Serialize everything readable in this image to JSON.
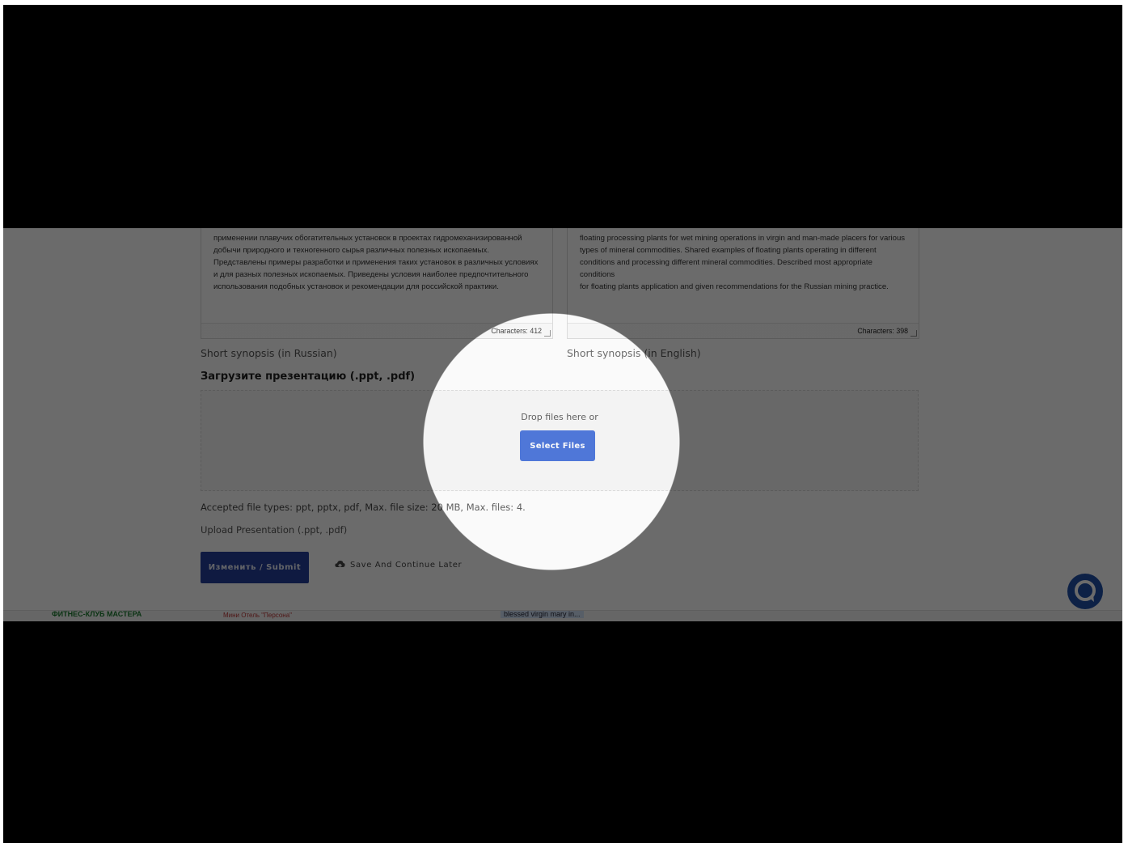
{
  "form": {
    "synopsis_ru": {
      "text": "применении плавучих обогатительных установок в проектах гидромеханизированной\nдобычи природного и техногенного сырья различных полезных ископаемых.\nПредставлены примеры разработки и применения таких установок в различных условиях\nи для разных полезных ископаемых. Приведены условия наиболее предпочтительного\nиспользования подобных установок и рекомендации для российской практики.",
      "counter": "Characters: 412",
      "description": "Short synopsis (in Russian)"
    },
    "synopsis_en": {
      "text": "floating processing plants for wet mining operations in virgin and man-made placers for various\ntypes of mineral commodities. Shared examples of floating plants operating in different\nconditions and processing different mineral commodities. Described most appropriate conditions\nfor floating plants application and given recommendations for the Russian mining practice.",
      "counter": "Characters: 398",
      "description": "Short synopsis (in English)"
    },
    "upload": {
      "heading": "Загрузите презентацию (.ppt, .pdf)",
      "drop_text": "Drop files here or",
      "select_label": "Select Files",
      "accepted": "Accepted file types: ppt, pptx, pdf, Max. file size: 20 MB, Max. files: 4.",
      "label": "Upload Presentation (.ppt, .pdf)"
    },
    "actions": {
      "submit_label": "Изменить / Submit",
      "save_later_label": "Save And Continue Later"
    }
  },
  "ads": {
    "item1": "ФИТНЕС-КЛУБ МАСТЕРА",
    "item2": "Мини Отель \"Персона\"",
    "item3": "blessed virgin mary in..."
  },
  "colors": {
    "primary_button": "#2f60d6",
    "submit_button": "#233f9a",
    "chat_button": "#1f4fa8"
  },
  "icons": {
    "save_later": "cloud-upload-icon",
    "chat": "chat-bubble-icon"
  }
}
